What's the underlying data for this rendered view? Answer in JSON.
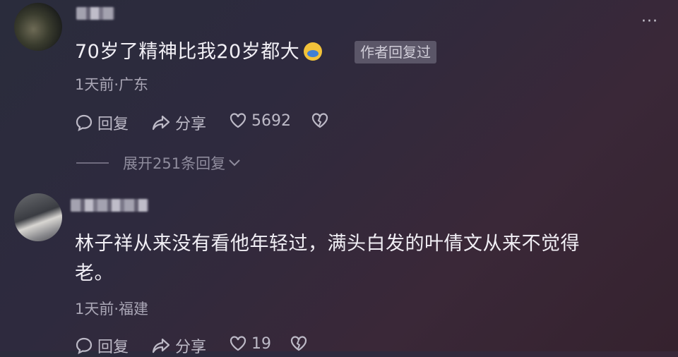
{
  "comments": [
    {
      "text": "70岁了精神比我20岁都大",
      "author_badge": "作者回复过",
      "time_location": "1天前·广东",
      "reply_label": "回复",
      "share_label": "分享",
      "like_count": "5692",
      "expand_label": "展开251条回复"
    },
    {
      "text_line1": "林子祥从来没有看他年轻过，满头白发的叶倩文从来不觉得",
      "text_line2": "老。",
      "time_location": "1天前·福建",
      "reply_label": "回复",
      "share_label": "分享",
      "like_count": "19"
    }
  ],
  "more_glyph": "···",
  "icons": [
    "reply-icon",
    "share-icon",
    "heart-icon",
    "broken-heart-icon",
    "emoji-icon"
  ]
}
